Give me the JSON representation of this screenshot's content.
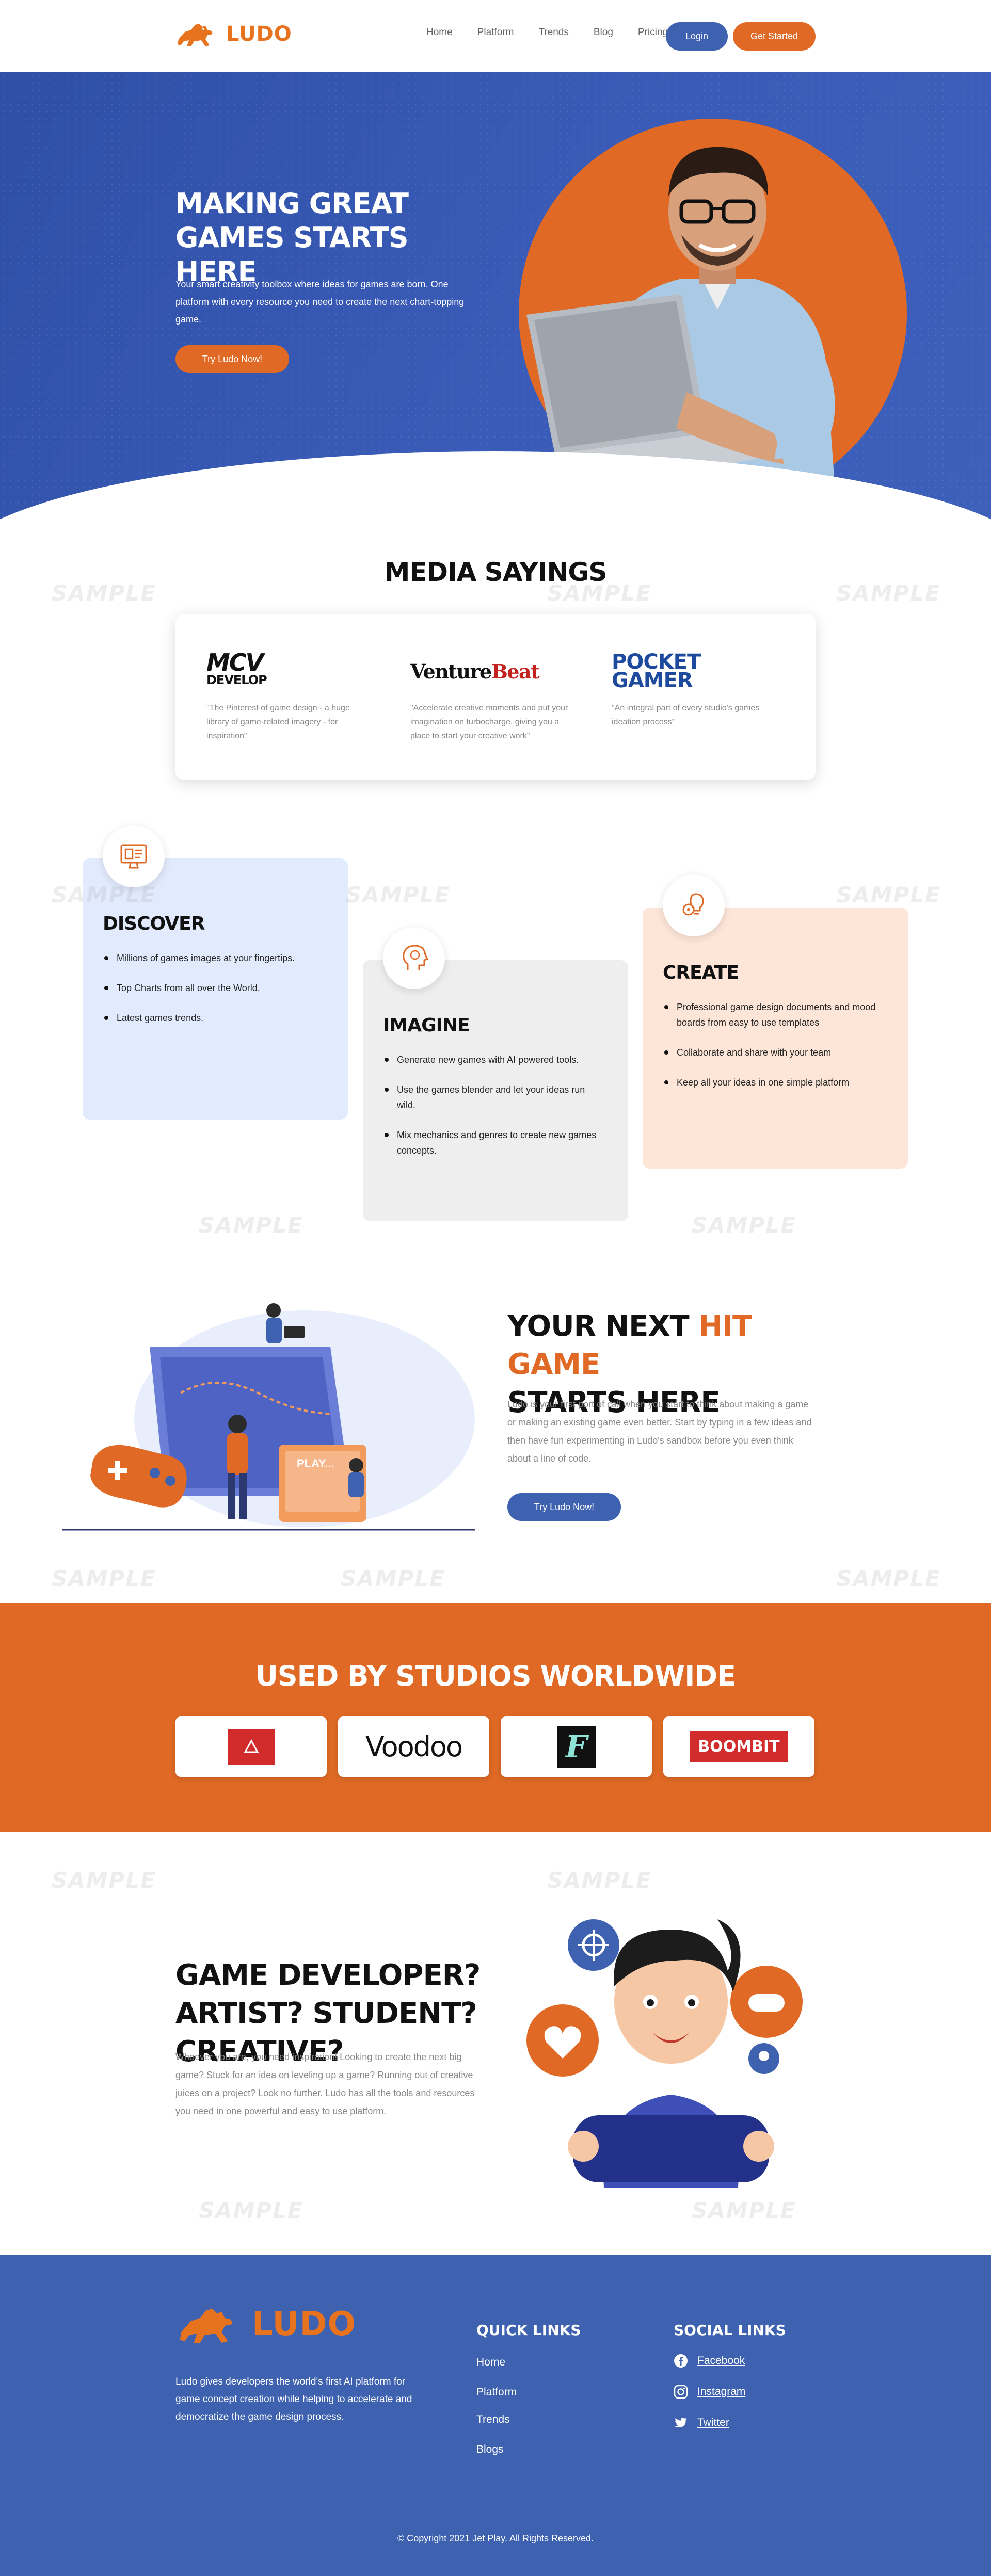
{
  "colors": {
    "brand_blue": "#3e62b0",
    "brand_orange": "#e06a25",
    "text_dark": "#111111",
    "text_muted": "#888888"
  },
  "header": {
    "logo_text": "LUDO",
    "nav": [
      "Home",
      "Platform",
      "Trends",
      "Blog",
      "Pricing"
    ],
    "login_label": "Login",
    "get_started_label": "Get Started"
  },
  "hero": {
    "title_line1": "MAKING GREAT",
    "title_line2": "GAMES STARTS HERE",
    "subtitle": "Your smart creativity toolbox where ideas for games are born. One platform with every resource you need to create the next chart-topping game.",
    "cta_label": "Try Ludo Now!"
  },
  "media": {
    "title": "MEDIA SAYINGS",
    "items": [
      {
        "logo": "MCV\nDEVELOP",
        "quote": "\"The Pinterest of game design - a huge library of game-related imagery - for inspiration\""
      },
      {
        "logo": "VentureBeat",
        "quote": "\"Accelerate creative moments and put your imagination on turbocharge, giving you a place to start your creative work\""
      },
      {
        "logo": "POCKET GAMER",
        "quote": "\"An integral part of every studio's games ideation process\""
      }
    ]
  },
  "features": [
    {
      "title": "DISCOVER",
      "icon": "monitor-icon",
      "items": [
        "Millions of games images at your fingertips.",
        "Top Charts from all over the World.",
        "Latest games trends."
      ]
    },
    {
      "title": "IMAGINE",
      "icon": "head-lightbulb-icon",
      "items": [
        "Generate new games with AI powered tools.",
        "Use the games blender and let your ideas run wild.",
        "Mix mechanics and genres to create new games concepts."
      ]
    },
    {
      "title": "CREATE",
      "icon": "gears-lightbulb-icon",
      "items": [
        "Professional game design documents and mood boards from easy to use templates",
        "Collaborate and share with your team",
        "Keep all your ideas in one simple platform"
      ]
    }
  ],
  "hit": {
    "title_prefix": "YOUR NEXT ",
    "title_accent": "HIT GAME",
    "title_line2": "STARTS HERE",
    "desc": "Ludo is your first port of call when you start to think about making a game or making an existing game even better. Start by typing in a few ideas and then have fun experimenting in Ludo's sandbox before you even think about a line of code.",
    "cta_label": "Try Ludo Now!",
    "illustration_text": "PLAY..."
  },
  "studios": {
    "title": "USED BY STUDIOS WORLDWIDE",
    "logos": [
      "red-studio-logo",
      "Voodoo",
      "F",
      "BOOMBIT"
    ]
  },
  "gamedev": {
    "title_line1": "GAME DEVELOPER?",
    "title_line2": "ARTIST? STUDENT? CREATIVE?",
    "desc": "Whoever you are, you need inspiration! Looking to create the next big game? Stuck for an idea on leveling up a game? Running out of creative juices on a project? Look no further. Ludo has all the tools and resources you need in one powerful and easy to use platform."
  },
  "footer": {
    "logo_text": "LUDO",
    "desc": "Ludo gives developers the world's first AI platform for game concept creation while helping to accelerate and democratize the game design process.",
    "quick_links_title": "QUICK LINKS",
    "quick_links": [
      "Home",
      "Platform",
      "Trends",
      "Blogs"
    ],
    "social_title": "SOCIAL LINKS",
    "social": [
      {
        "label": "Facebook",
        "icon": "facebook-icon"
      },
      {
        "label": "Instagram",
        "icon": "instagram-icon"
      },
      {
        "label": "Twitter",
        "icon": "twitter-icon"
      }
    ],
    "copyright": "© Copyright 2021 Jet Play. All Rights Reserved."
  },
  "watermark": "SAMPLE"
}
